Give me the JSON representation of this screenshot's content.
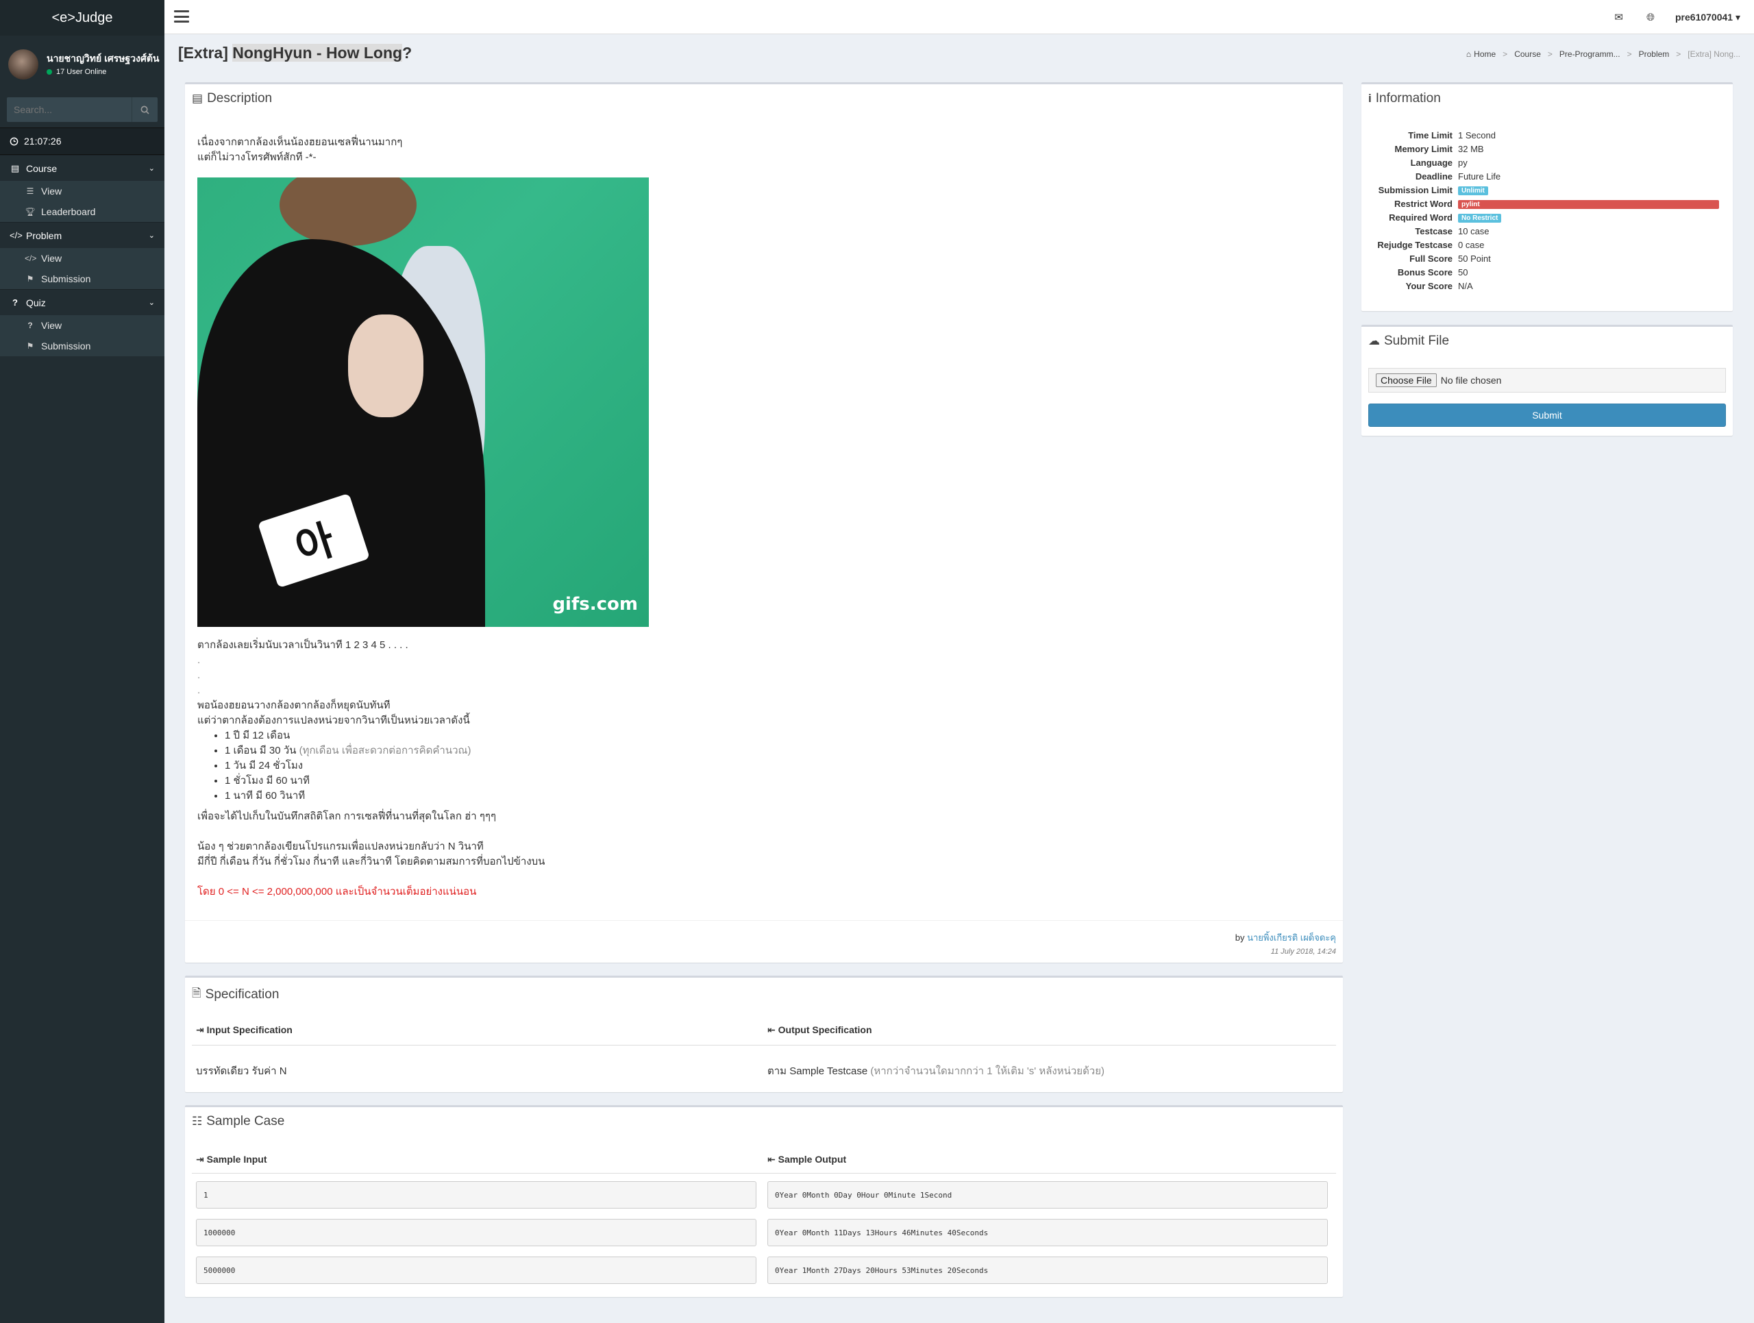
{
  "app": {
    "logo": "<e>Judge"
  },
  "user": {
    "name": "นายชาญวิทย์ เศรษฐวงศ์ต้น",
    "online": "17 User Online"
  },
  "search": {
    "placeholder": "Search..."
  },
  "clock": "21:07:26",
  "sidebar": {
    "sections": [
      {
        "label": "Course",
        "icon": "table-icon",
        "items": [
          {
            "label": "View",
            "icon": "list-icon"
          },
          {
            "label": "Leaderboard",
            "icon": "trophy-icon"
          }
        ]
      },
      {
        "label": "Problem",
        "icon": "code-icon",
        "items": [
          {
            "label": "View",
            "icon": "code-icon"
          },
          {
            "label": "Submission",
            "icon": "flag-icon"
          }
        ]
      },
      {
        "label": "Quiz",
        "icon": "question-icon",
        "items": [
          {
            "label": "View",
            "icon": "question-icon"
          },
          {
            "label": "Submission",
            "icon": "flag-icon"
          }
        ]
      }
    ]
  },
  "topnav": {
    "username": "pre61070041"
  },
  "page": {
    "title_prefix": "[Extra] ",
    "title_highlight": "NongHyun - How Long",
    "title_suffix": "?"
  },
  "breadcrumb": [
    "Home",
    "Course",
    "Pre-Programm...",
    "Problem",
    "[Extra] Nong..."
  ],
  "description": {
    "heading": "Description",
    "intro_1": "เนื่องจากตากล้องเห็นน้องฮยอนเซลฟี่นานมากๆ",
    "intro_2": "แต่ก็ไม่วางโทรศัพท์สักที -*-",
    "gif_watermark": "gifs.com",
    "gif_tag": "아",
    "line_count": "ตากล้องเลยเริ่มนับเวลาเป็นวินาที 1 2 3 4 5 . . . .",
    "dot_1": ".",
    "dot_2": ".",
    "dot_3": ".",
    "line_stop": "พอน้องฮยอนวางกล้องตากล้องก็หยุดนับทันที",
    "line_convert": "แต่ว่าตากล้องต้องการแปลงหน่วยจากวินาทีเป็นหน่วยเวลาดังนี้",
    "list": [
      {
        "text": "1 ปี มี 12 เดือน",
        "note": ""
      },
      {
        "text": "1 เดือน มี 30 วัน ",
        "note": "(ทุกเดือน เพื่อสะดวกต่อการคิดคำนวณ)"
      },
      {
        "text": "1 วัน มี 24 ชั่วโมง",
        "note": ""
      },
      {
        "text": "1 ชั่วโมง มี 60 นาที",
        "note": ""
      },
      {
        "text": "1 นาที มี 60 วินาที",
        "note": ""
      }
    ],
    "line_record": "เพื่อจะได้ไปเก็บในบันทึกสถิติโลก การเซลฟี่ที่นานที่สุดในโลก  ฮ่า ๆๆๆ",
    "line_help_1": "น้อง ๆ ช่วยตากล้องเขียนโปรแกรมเพื่อแปลงหน่วยกลับว่า N วินาที",
    "line_help_2": "มีกี่ปี กี่เดือน กี่วัน กี่ชั่วโมง กี่นาที และกี่วินาที โดยคิดตามสมการที่บอกไปข้างบน",
    "constraint": "โดย 0 <= N <= 2,000,000,000  และเป็นจำนวนเต็มอย่างแน่นอน",
    "by": "by ",
    "author": "นายพิ้งเกียรติ เผด็จดะคุ",
    "date": "11 July 2018, 14:24"
  },
  "specification": {
    "heading": "Specification",
    "input_label": "Input Specification",
    "output_label": "Output Specification",
    "input_value": "บรรทัดเดียว รับค่า N",
    "output_value": "ตาม Sample Testcase ",
    "output_note": "(หากว่าจำนวนใดมากกว่า 1 ให้เติม 's' หลังหน่วยด้วย)"
  },
  "sample_case": {
    "heading": "Sample Case",
    "input_label": "Sample Input",
    "output_label": "Sample Output",
    "rows": [
      {
        "input": "1",
        "output": "0Year 0Month 0Day 0Hour 0Minute 1Second"
      },
      {
        "input": "1000000",
        "output": "0Year 0Month 11Days 13Hours 46Minutes 40Seconds"
      },
      {
        "input": "5000000",
        "output": "0Year 1Month 27Days 20Hours 53Minutes 20Seconds"
      }
    ]
  },
  "information": {
    "heading": "Information",
    "rows": [
      {
        "key": "Time Limit",
        "value": "1 Second"
      },
      {
        "key": "Memory Limit",
        "value": "32 MB"
      },
      {
        "key": "Language",
        "value": "py"
      },
      {
        "key": "Deadline",
        "value": "Future Life"
      },
      {
        "key": "Submission Limit",
        "value": "Unlimit",
        "badge": "blue"
      },
      {
        "key": "Restrict Word",
        "value": "pylint",
        "badge": "red"
      },
      {
        "key": "Required Word",
        "value": "No Restrict",
        "badge": "blue"
      },
      {
        "key": "Testcase",
        "value": "10 case"
      },
      {
        "key": "Rejudge Testcase",
        "value": "0 case"
      },
      {
        "key": "Full Score",
        "value": "50 Point"
      },
      {
        "key": "Bonus Score",
        "value": "50"
      },
      {
        "key": "Your Score",
        "value": "N/A"
      }
    ]
  },
  "submit_file": {
    "heading": "Submit File",
    "choose_label": "Choose File",
    "file_status": "No file chosen",
    "submit_label": "Submit"
  },
  "colors": {
    "sidebar": "#222d32",
    "accent": "#3c8dbc",
    "danger": "#d9534f",
    "info": "#5bc0de"
  }
}
